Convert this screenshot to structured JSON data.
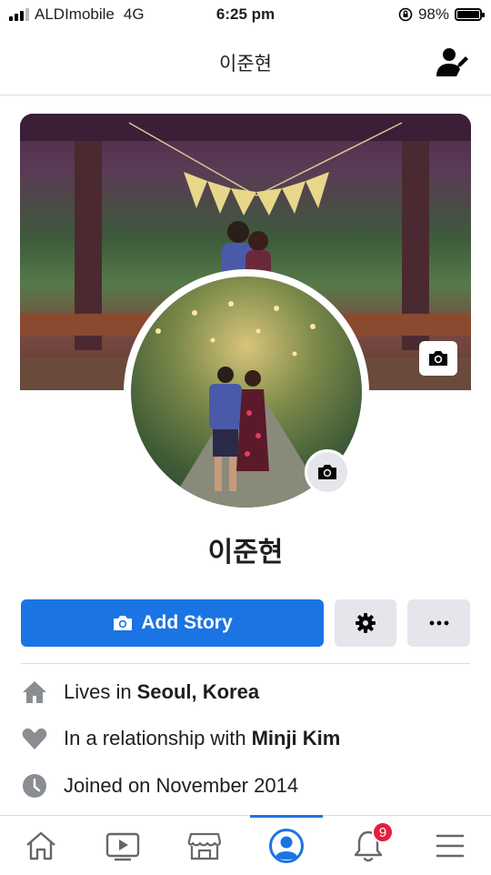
{
  "status_bar": {
    "carrier": "ALDImobile",
    "network": "4G",
    "time": "6:25 pm",
    "battery": "98%",
    "battery_level": 0.98
  },
  "header": {
    "title": "이준현"
  },
  "profile": {
    "name": "이준현"
  },
  "actions": {
    "add_story_label": "Add Story"
  },
  "intro": {
    "lives_prefix": "Lives in",
    "lives_value": "Seoul, Korea",
    "relationship_prefix": "In a relationship with",
    "relationship_value": "Minji Kim",
    "joined": "Joined on November 2014"
  },
  "bottom_nav": {
    "items": [
      "home-icon",
      "watch-icon",
      "marketplace-icon",
      "profile-icon",
      "notifications-icon",
      "menu-icon"
    ],
    "active": "profile-icon",
    "notification_count": "9"
  },
  "colors": {
    "accent": "#1b74e4",
    "button_gray": "#e4e6eb",
    "badge_red": "#e41e3f",
    "icon_gray": "#65676b"
  }
}
